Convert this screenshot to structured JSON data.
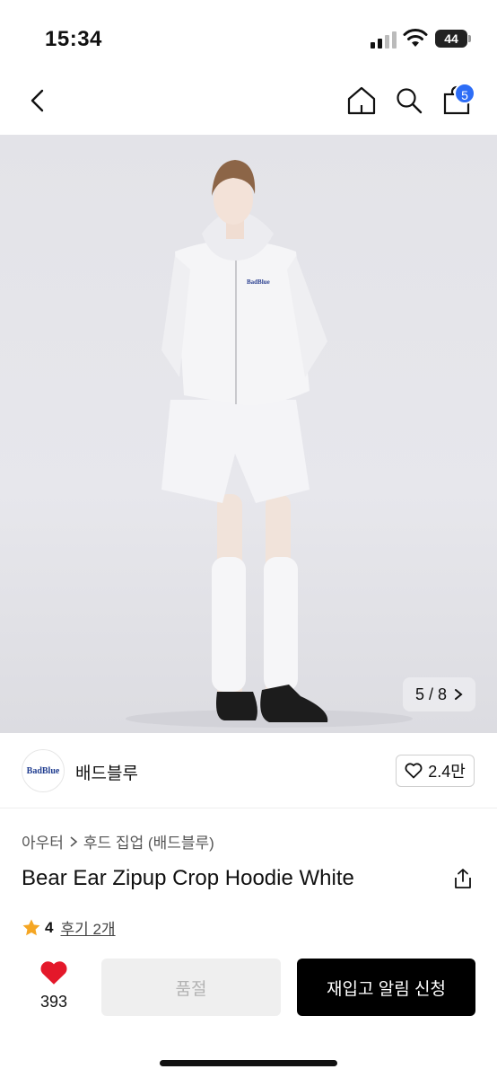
{
  "status": {
    "time": "15:34",
    "battery": "44"
  },
  "nav": {
    "cart_badge": "5"
  },
  "gallery": {
    "counter": "5 / 8"
  },
  "brand": {
    "logo_text": "BadBlue",
    "name": "배드블루",
    "likes": "2.4만"
  },
  "breadcrumb": {
    "level1": "아우터",
    "level2": "후드 집업 (배드블루)"
  },
  "product": {
    "title": "Bear Ear Zipup Crop Hoodie White",
    "rating": "4",
    "review_link": "후기 2개"
  },
  "actions": {
    "wish_count": "393",
    "sold_out_label": "품절",
    "restock_label": "재입고 알림 신청"
  },
  "colors": {
    "accent_badge": "#2d6df6",
    "heart": "#e4182a",
    "star": "#f5a623"
  },
  "icons": [
    "back-icon",
    "home-icon",
    "search-icon",
    "bag-icon",
    "chevron-right-icon",
    "heart-outline-icon",
    "share-icon",
    "star-icon",
    "heart-filled-icon"
  ]
}
